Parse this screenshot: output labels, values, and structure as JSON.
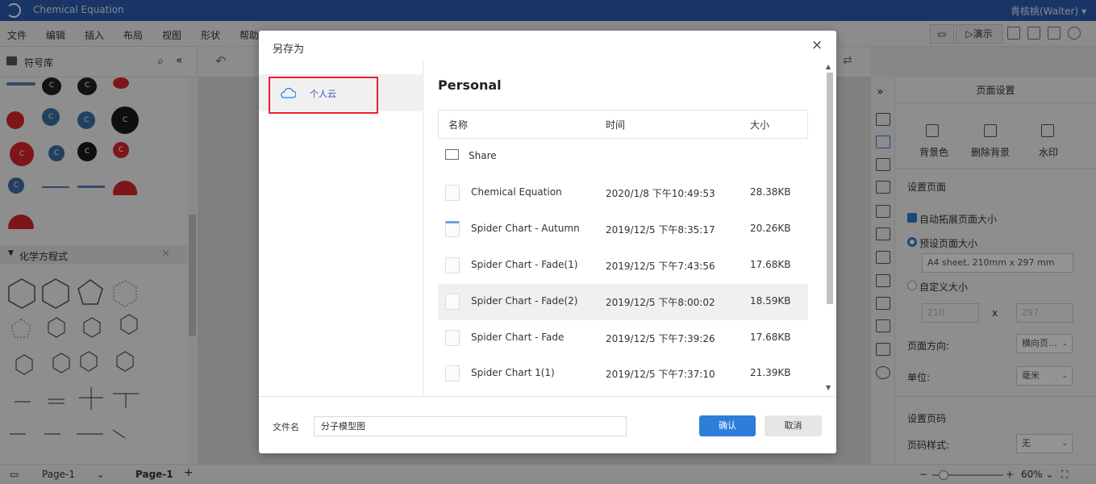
{
  "app": {
    "title": "Chemical Equation",
    "user": "青核桃(Walter)"
  },
  "menu": [
    "文件",
    "编辑",
    "插入",
    "布局",
    "视图",
    "形状",
    "帮助"
  ],
  "toolbar_right": {
    "present_label": "演示"
  },
  "left_panel": {
    "title": "符号库",
    "section2_title": "化学方程式",
    "ball_label": "C"
  },
  "right_panel": {
    "title": "页面设置",
    "bg_color": "背景色",
    "remove_bg": "删除背景",
    "watermark": "水印",
    "page_setup": "设置页面",
    "auto_expand": "自动拓展页面大小",
    "preset_size": "预设页面大小",
    "preset_value": "A4 sheet, 210mm x 297 mm",
    "custom_size": "自定义大小",
    "width_value": "210",
    "x_label": "x",
    "height_value": "297",
    "orientation_label": "页面方向:",
    "orientation_value": "横向页...",
    "unit_label": "单位:",
    "unit_value": "毫米",
    "page_number_header": "设置页码",
    "page_number_style_label": "页码样式:",
    "page_number_style_value": "无"
  },
  "statusbar": {
    "page_select": "Page-1",
    "page_tab": "Page-1",
    "add": "+",
    "zoom": "60%"
  },
  "dialog": {
    "title": "另存为",
    "close": "×",
    "location": "个人云",
    "heading": "Personal",
    "columns": {
      "name": "名称",
      "time": "时间",
      "size": "大小"
    },
    "rows": [
      {
        "name": "Share",
        "time": "",
        "size": ""
      },
      {
        "name": "Chemical Equation",
        "time": "2020/1/8 下午10:49:53",
        "size": "28.38KB"
      },
      {
        "name": "Spider Chart - Autumn",
        "time": "2019/12/5 下午8:35:17",
        "size": "20.26KB"
      },
      {
        "name": "Spider Chart - Fade(1)",
        "time": "2019/12/5 下午7:43:56",
        "size": "17.68KB"
      },
      {
        "name": "Spider Chart - Fade(2)",
        "time": "2019/12/5 下午8:00:02",
        "size": "18.59KB"
      },
      {
        "name": "Spider Chart - Fade",
        "time": "2019/12/5 下午7:39:26",
        "size": "17.68KB"
      },
      {
        "name": "Spider Chart 1(1)",
        "time": "2019/12/5 下午7:37:10",
        "size": "21.39KB"
      }
    ],
    "filename_label": "文件名",
    "filename_value": "分子模型图",
    "ok": "确认",
    "cancel": "取消"
  },
  "colors": {
    "accent": "#2d7ed8",
    "titlebar": "#2b5cb0",
    "highlight": "#e8212b",
    "red_ball": "#d9262b",
    "blue_ball": "#3d6fa8"
  }
}
